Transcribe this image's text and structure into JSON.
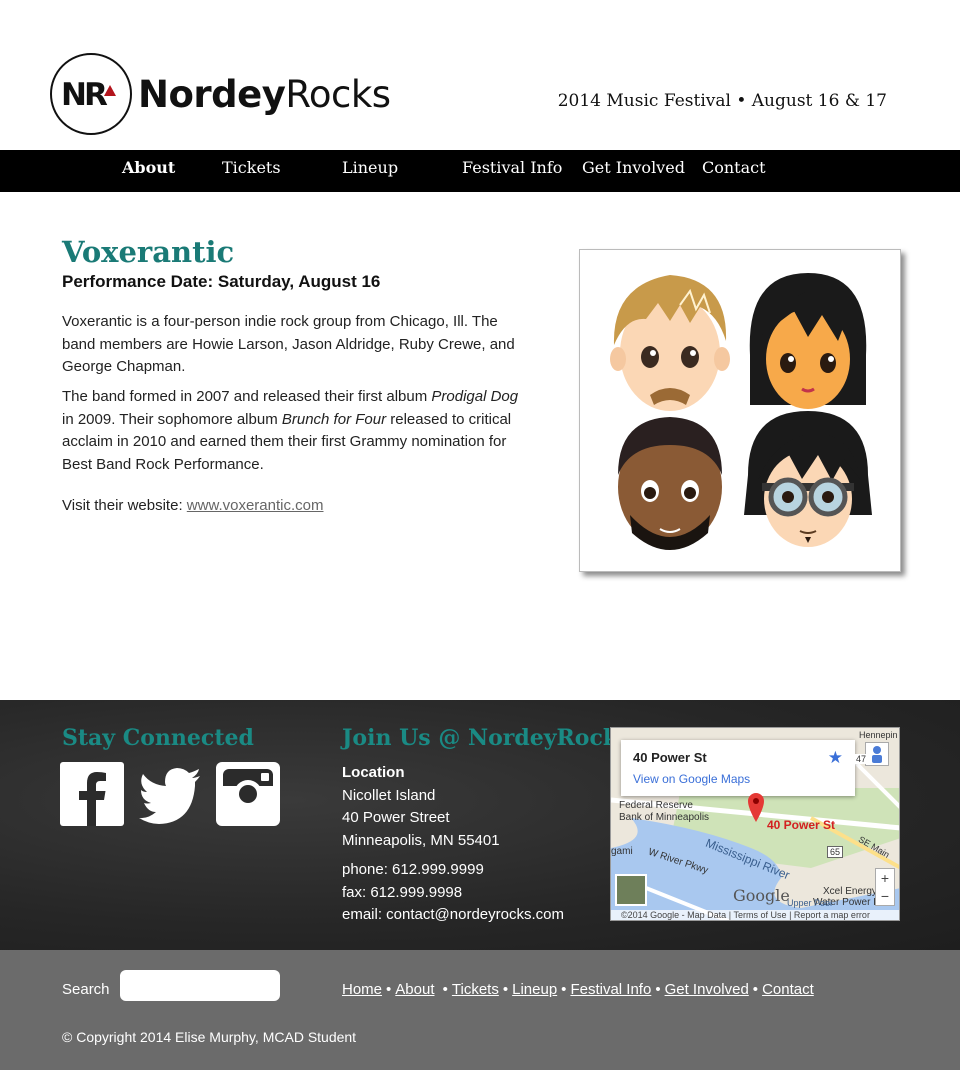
{
  "header": {
    "logo_monogram": "NR",
    "logo_name_bold": "Nordey",
    "logo_name_light": "Rocks",
    "tagline": "2014 Music Festival • August 16 & 17"
  },
  "nav": {
    "items": [
      {
        "label": "About",
        "active": true
      },
      {
        "label": "Tickets"
      },
      {
        "label": "Lineup"
      },
      {
        "label": "Festival Info"
      },
      {
        "label": "Get Involved"
      },
      {
        "label": "Contact"
      }
    ]
  },
  "main": {
    "band_name": "Voxerantic",
    "performance_date": "Performance Date: Saturday, August 16",
    "bio_1": "Voxerantic is a four-person indie rock group from Chicago, Ill. The band members are Howie Larson, Jason Aldridge, Ruby Crewe, and George Chapman.",
    "bio_2_a": "The band formed in 2007 and released their first album ",
    "bio_2_album1": "Prodigal Dog",
    "bio_2_b": " in 2009. Their sophomore album ",
    "bio_2_album2": "Brunch for Four",
    "bio_2_c": " released to critical acclaim in 2010 and earned them their first Grammy nomination for Best Band Rock Performance.",
    "website_label": "Visit their website: ",
    "website_link": "www.voxerantic.com"
  },
  "footer": {
    "stay_connected": "Stay Connected",
    "join_us": "Join Us @ NordeyRock",
    "location_label": "Location",
    "location_lines": [
      "Nicollet Island",
      "40 Power Street",
      "Minneapolis, MN 55401"
    ],
    "phone": "phone: 612.999.9999",
    "fax": "fax: 612.999.9998",
    "email": "email: contact@nordeyrocks.com",
    "map": {
      "place_title": "40 Power St",
      "view_link": "View on Google Maps",
      "pin_label": "40 Power St",
      "labels": [
        "Federal Reserve",
        "Bank of Minneapolis",
        "Mississippi River",
        "W River Pkwy",
        "Xcel Energy",
        "Water Power Park",
        "Upper Pool",
        "SE Main",
        "Hennepin",
        "gami",
        "65",
        "47"
      ],
      "google": "Google",
      "attrib": "©2014 Google - Map Data",
      "terms": "Terms of Use",
      "report": "Report a map error"
    },
    "search_label": "Search",
    "search_value": "",
    "links": [
      "Home",
      "About",
      "Tickets",
      "Lineup",
      "Festival Info",
      "Get Involved",
      "Contact"
    ],
    "copyright": "© Copyright 2014 Elise Murphy, MCAD Student"
  },
  "colors": {
    "accent_teal": "#1a7a76",
    "nav_bg": "#000000",
    "footer_dark": "#2b2b2b",
    "footer_gray": "#6b6b6b",
    "logo_red": "#b3141c"
  }
}
